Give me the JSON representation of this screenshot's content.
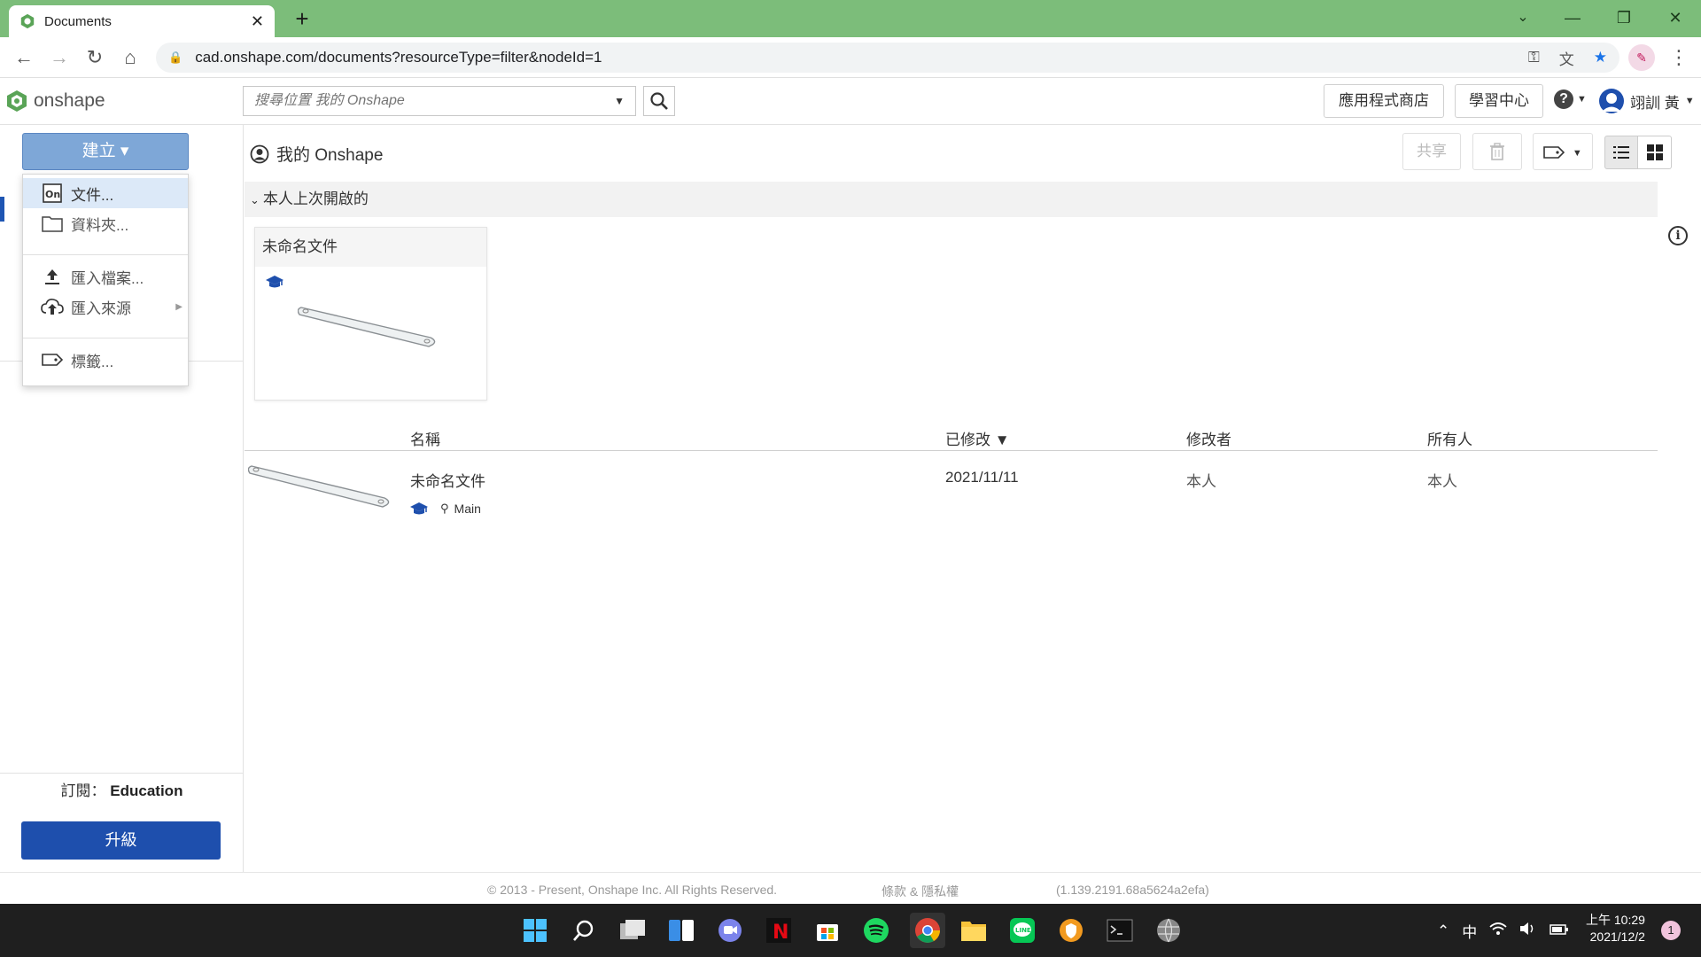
{
  "browser": {
    "tab_title": "Documents",
    "tab_close": "✕",
    "new_tab": "+",
    "url": "cad.onshape.com/documents?resourceType=filter&nodeId=1",
    "win_min": "—",
    "win_restore": "❐",
    "win_close": "✕",
    "win_list": "⌄"
  },
  "header": {
    "logo_text": "onshape",
    "search_placeholder": "搜尋位置 我的 Onshape",
    "app_store": "應用程式商店",
    "learning_center": "學習中心",
    "user_name": "翊訓 黃"
  },
  "sidebar": {
    "create_label": "建立 ▾",
    "subscription_label": "訂閱：",
    "subscription_value": "Education",
    "upgrade_label": "升級"
  },
  "create_menu": {
    "items": [
      {
        "label": "文件..."
      },
      {
        "label": "資料夾..."
      },
      {
        "label": "匯入檔案..."
      },
      {
        "label": "匯入來源"
      },
      {
        "label": "標籤..."
      }
    ]
  },
  "main": {
    "title": "我的 Onshape",
    "share": "共享",
    "recent_section": "本人上次開啟的",
    "recent_card_title": "未命名文件",
    "columns": {
      "name": "名稱",
      "modified": "已修改 ▼",
      "modified_by": "修改者",
      "owner": "所有人"
    },
    "rows": [
      {
        "name": "未命名文件",
        "branch": "Main",
        "modified": "2021/11/11",
        "modified_by": "本人",
        "owner": "本人"
      }
    ]
  },
  "footer": {
    "copyright": "© 2013 - Present, Onshape Inc. All Rights Reserved.",
    "terms": "條款 & 隱私權",
    "version": "(1.139.2191.68a5624a2efa)"
  },
  "taskbar": {
    "ime": "中",
    "time": "上午 10:29",
    "date": "2021/12/2",
    "notifications": "1"
  },
  "colors": {
    "chrome_green": "#7cbd7a",
    "accent_blue": "#1e4fad",
    "create_button": "#7ea7d7"
  }
}
